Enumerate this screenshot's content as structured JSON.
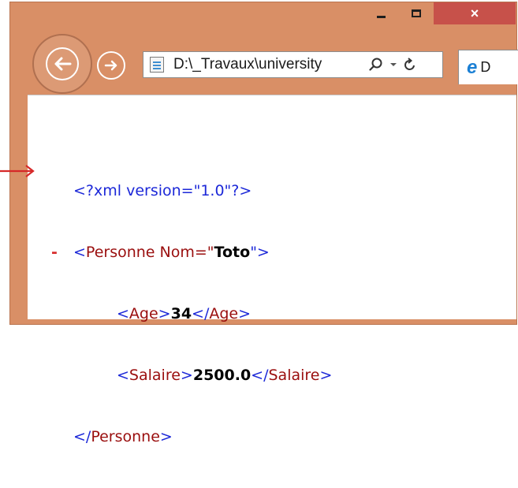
{
  "window": {
    "close_glyph": "×"
  },
  "nav": {
    "back_icon": "back-arrow-icon",
    "forward_icon": "forward-arrow-icon"
  },
  "address_bar": {
    "url": "D:\\_Travaux\\university",
    "search_icon": "search-icon",
    "dropdown_icon": "chevron-down-icon",
    "refresh_icon": "refresh-icon"
  },
  "tab": {
    "icon": "ie-icon",
    "label": "D"
  },
  "xml": {
    "declaration": "<?xml version=\"1.0\"?>",
    "collapse_marker": "-",
    "root_open_tag": "<Personne",
    "root_attr_name": " Nom=\"",
    "root_attr_value": "Toto",
    "root_attr_close": "\">",
    "age_open": "<Age>",
    "age_value": "34",
    "age_close": "</Age>",
    "salary_open": "<Salaire>",
    "salary_value": "2500.0",
    "salary_close": "</Salaire>",
    "root_close_tag": "</Personne>"
  },
  "colors": {
    "frame": "#d98f66",
    "close_button": "#c7514a",
    "xml_markup": "#1c28d8",
    "xml_tag_name": "#9a0e0e",
    "annotation_arrow": "#d62828"
  }
}
